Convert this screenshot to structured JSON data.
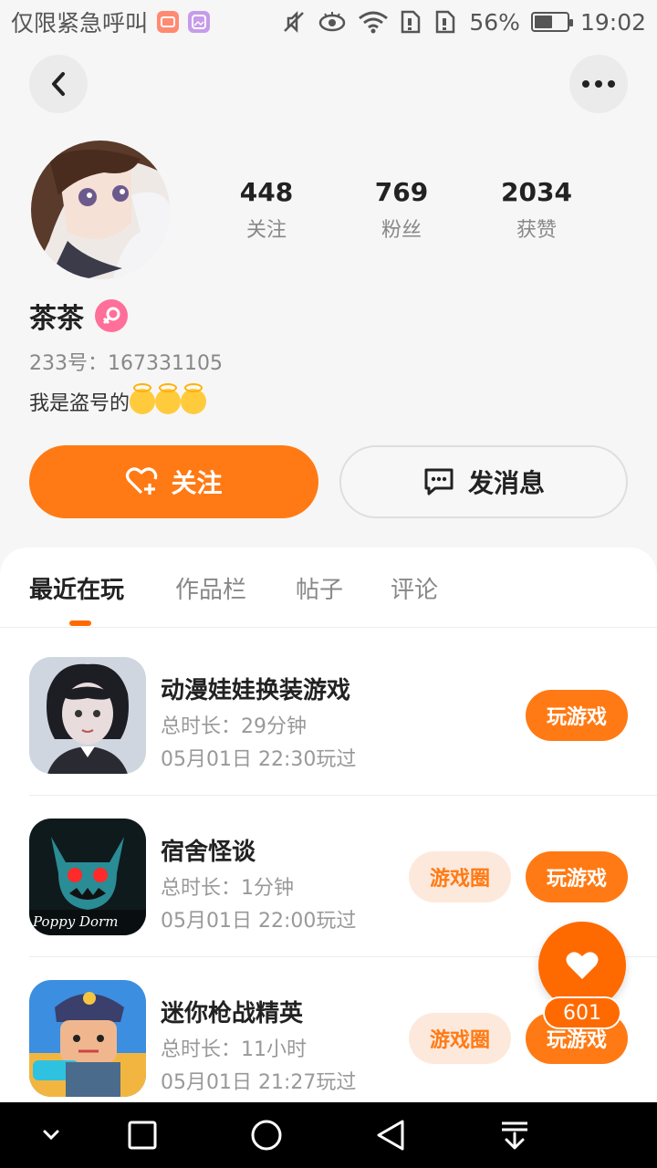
{
  "status_bar": {
    "emergency_text": "仅限紧急呼叫",
    "battery_percent": "56%",
    "battery_level": 0.56,
    "time": "19:02"
  },
  "header": {
    "back_icon": "chevron-left-icon",
    "more_icon": "more-horizontal-icon"
  },
  "profile": {
    "name": "茶茶",
    "gender": "female",
    "uid_label": "233号：",
    "uid_value": "167331105",
    "bio": "我是盗号的",
    "bio_emojis": [
      "smiling-face-with-halo",
      "smiling-face-with-halo",
      "smiling-face-with-halo"
    ],
    "stats": [
      {
        "value": "448",
        "label": "关注"
      },
      {
        "value": "769",
        "label": "粉丝"
      },
      {
        "value": "2034",
        "label": "获赞"
      }
    ]
  },
  "actions": {
    "follow_label": "关注",
    "message_label": "发消息"
  },
  "tabs": [
    {
      "label": "最近在玩",
      "active": true
    },
    {
      "label": "作品栏",
      "active": false
    },
    {
      "label": "帖子",
      "active": false
    },
    {
      "label": "评论",
      "active": false
    }
  ],
  "games": [
    {
      "title": "动漫娃娃换装游戏",
      "duration": "总时长：29分钟",
      "last_played": "05月01日 22:30玩过",
      "play_label": "玩游戏"
    },
    {
      "title": "宿舍怪谈",
      "duration": "总时长：1分钟",
      "last_played": "05月01日 22:00玩过",
      "circle_label": "游戏圈",
      "play_label": "玩游戏",
      "icon_text": "Poppy Dorm"
    },
    {
      "title": "迷你枪战精英",
      "duration": "总时长：11小时",
      "last_played": "05月01日 21:27玩过",
      "circle_label": "游戏圈",
      "play_label": "玩游戏"
    }
  ],
  "like_fab": {
    "count": "601"
  },
  "colors": {
    "accent": "#ff7a14",
    "accent_light": "#fde9dc",
    "gender_pink": "#ff6f99"
  }
}
